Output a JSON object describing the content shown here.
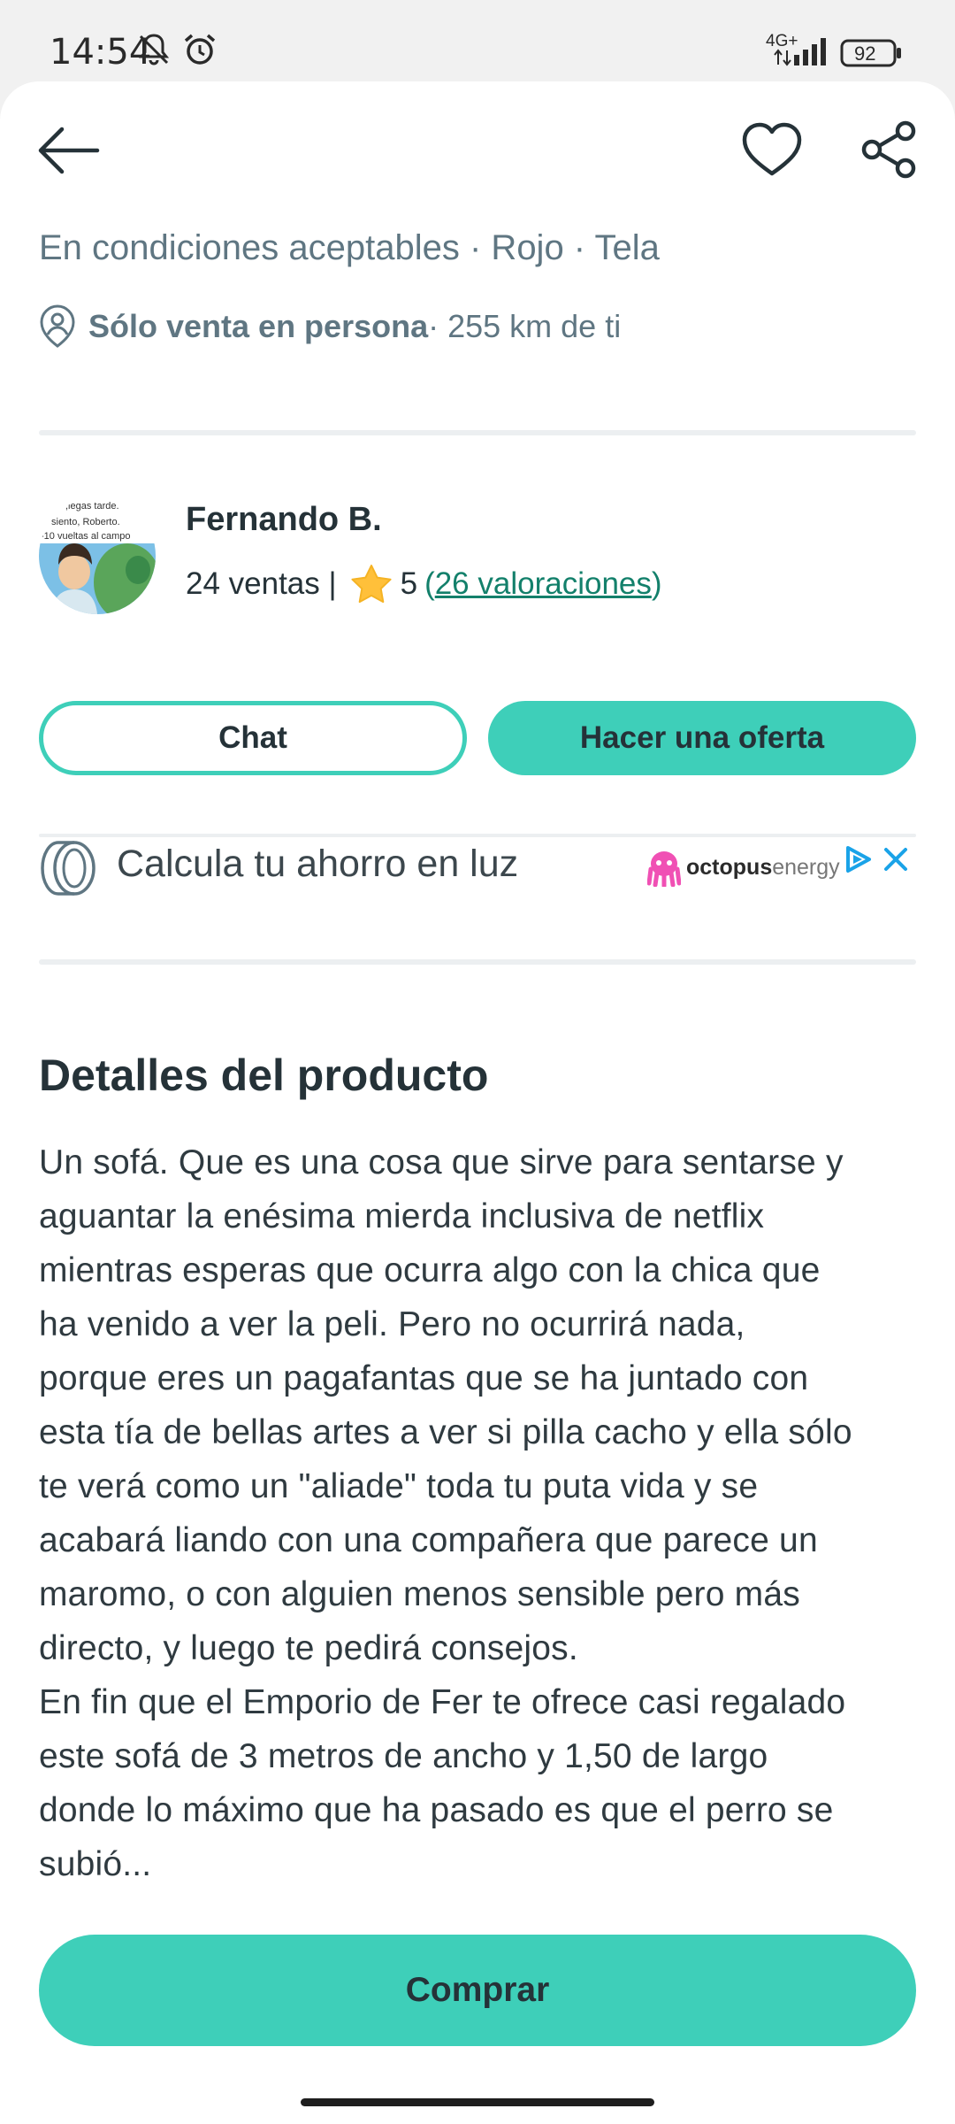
{
  "status_bar": {
    "time": "14:54",
    "network": "4G+",
    "battery": "92",
    "icons": [
      "bell-off-icon",
      "alarm-icon",
      "signal-icon",
      "battery-icon"
    ]
  },
  "toolbar": {
    "icons": [
      "back-arrow-icon",
      "heart-icon",
      "share-icon"
    ]
  },
  "product": {
    "meta": "En condiciones aceptables · Rojo · Tela",
    "location_strong": "Sólo venta en persona",
    "location_rest": " · 255 km de ti"
  },
  "seller": {
    "avatar_text": [
      ",legas tarde.",
      "siento, Roberto.",
      "-10 vueltas al campo"
    ],
    "name": "Fernando B.",
    "sales": "24 ventas |",
    "rating": "5",
    "reviews_open": "(",
    "reviews_link": "26 valoraciones",
    "reviews_close": ")"
  },
  "actions": {
    "chat_label": "Chat",
    "offer_label": "Hacer una oferta"
  },
  "ad": {
    "title": "Calcula tu ahorro en luz",
    "brand_bold": "octopus",
    "brand_light": "energy"
  },
  "details": {
    "title": "Detalles del producto",
    "description": "Un sofá. Que es una cosa que sirve para sentarse y\naguantar la enésima mierda inclusiva de netflix\nmientras esperas que ocurra algo con la chica que\nha venido a ver la peli. Pero no ocurrirá nada,\nporque eres un pagafantas que se ha juntado con\nesta tía de bellas artes a ver si pilla cacho y ella sólo\nte verá como un \"aliade\" toda tu puta vida y se\nacabará liando con una compañera que parece un\nmaromo, o con alguien menos sensible pero más\ndirecto, y luego te pedirá consejos.\nEn fin que el Emporio de Fer te ofrece casi regalado\neste sofá de 3 metros de ancho y 1,50 de largo\ndonde lo máximo que ha pasado es que el perro se\nsubió..."
  },
  "footer": {
    "buy_label": "Comprar"
  },
  "colors": {
    "accent": "#3ecfb9",
    "link": "#13806b",
    "text": "#253238",
    "muted": "#5f7682"
  }
}
